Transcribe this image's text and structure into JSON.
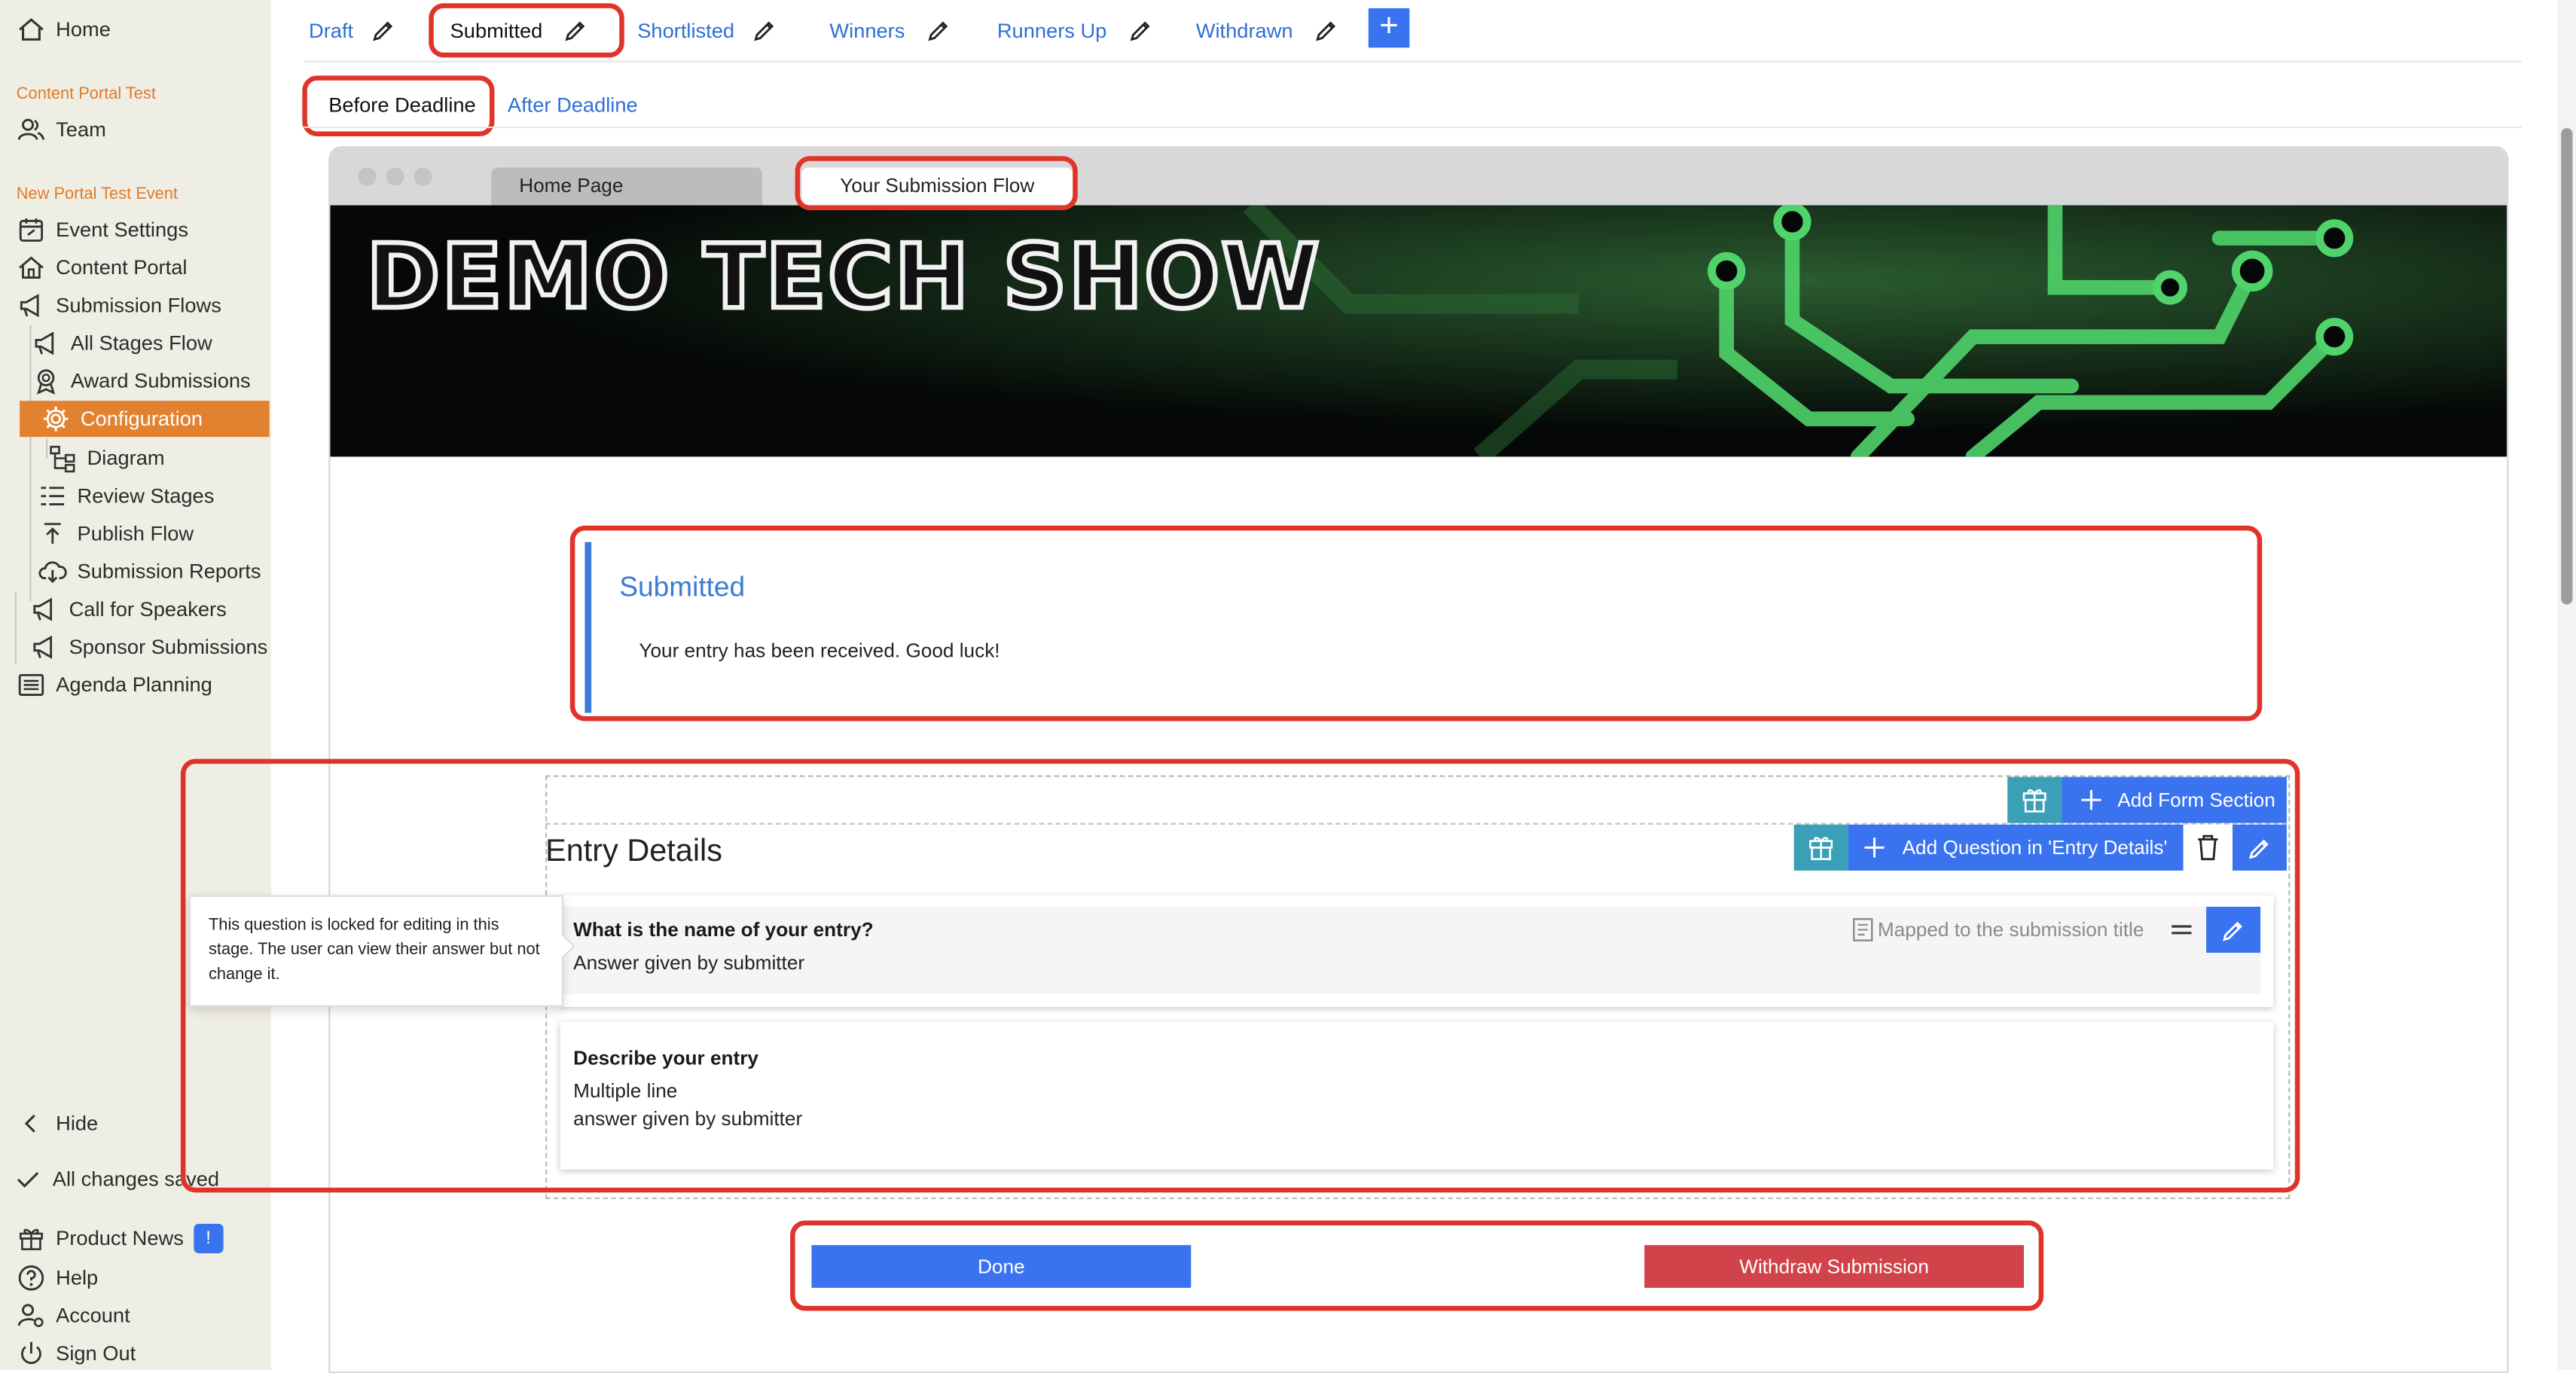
{
  "sidebar": {
    "home": "Home",
    "group1": "Content Portal Test",
    "team": "Team",
    "group2": "New Portal Test Event",
    "items": [
      "Event Settings",
      "Content Portal",
      "Submission Flows",
      "All Stages Flow",
      "Award Submissions",
      "Configuration",
      "Diagram",
      "Review Stages",
      "Publish Flow",
      "Submission Reports",
      "Call for Speakers",
      "Sponsor Submissions",
      "Agenda Planning"
    ],
    "hide": "Hide",
    "saved": "All changes saved",
    "product_news": "Product News",
    "news_badge": "!",
    "help": "Help",
    "account": "Account",
    "sign_out": "Sign Out"
  },
  "stage_tabs": [
    "Draft",
    "Submitted",
    "Shortlisted",
    "Winners",
    "Runners Up",
    "Withdrawn"
  ],
  "add_stage_label": "+",
  "deadline_tabs": [
    "Before Deadline",
    "After Deadline"
  ],
  "browser": {
    "tab1": "Home Page",
    "tab2": "Your Submission Flow",
    "banner_title": "DEMO TECH SHOW"
  },
  "notice": {
    "title": "Submitted",
    "text": "Your entry has been received. Good luck!"
  },
  "form": {
    "add_section": "Add Form Section",
    "section_title": "Entry Details",
    "add_question": "Add Question in 'Entry Details'",
    "tooltip": "This question is locked for editing in this stage. The user can view their answer but not change it.",
    "q1_title": "What is the name of your entry?",
    "q1_answer": "Answer given by submitter",
    "q1_mapped": "Mapped to the submission title",
    "q2_title": "Describe your entry",
    "q2_line1": "Multiple line",
    "q2_line2": "answer given by submitter"
  },
  "actions": {
    "done": "Done",
    "withdraw": "Withdraw Submission"
  },
  "colors": {
    "accent": "#3a73f0",
    "active_nav": "#e2812f",
    "highlight": "#e0342a",
    "danger": "#d0434b",
    "teal": "#3aa0b7"
  }
}
